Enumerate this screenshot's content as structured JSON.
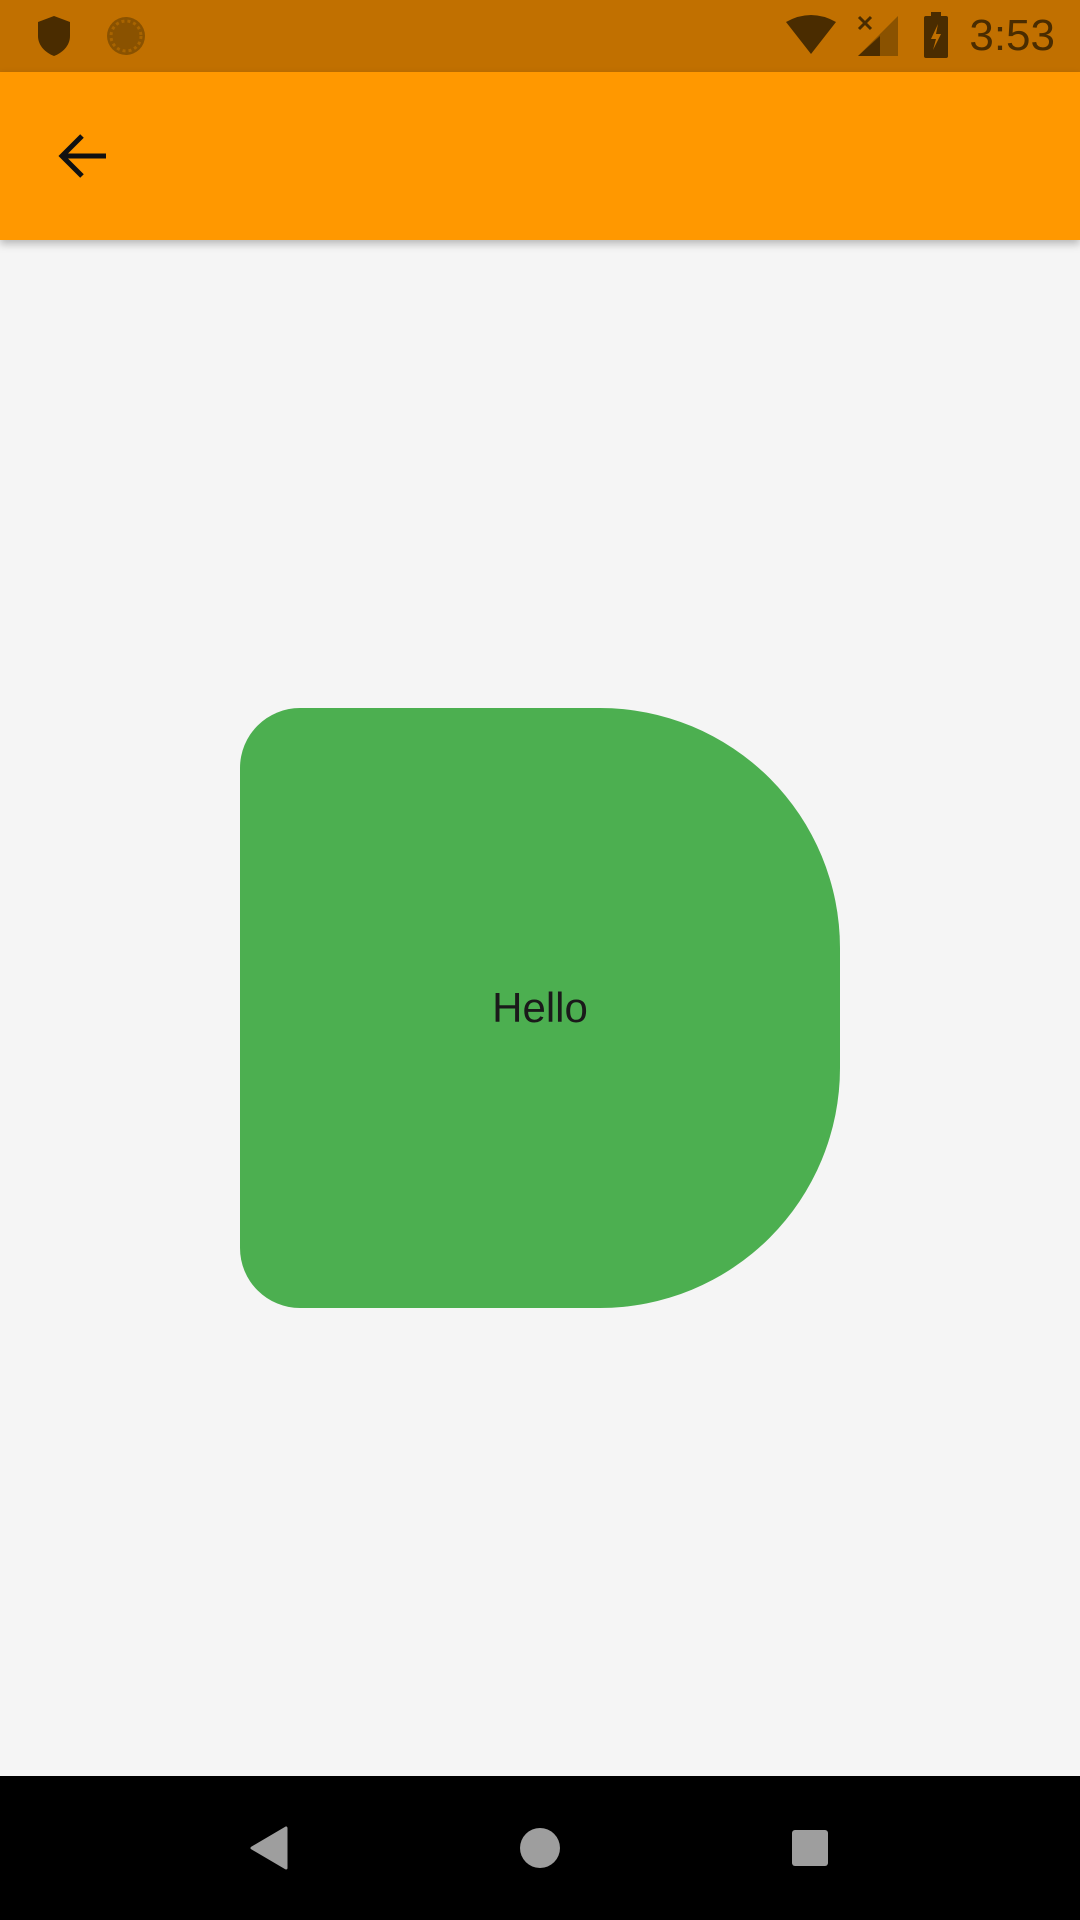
{
  "status_bar": {
    "time": "3:53",
    "icons": [
      "shield-icon",
      "sync-icon",
      "wifi-icon",
      "signal-no-service-icon",
      "battery-charging-icon"
    ]
  },
  "app_bar": {
    "back_icon": "arrow-back-icon"
  },
  "main": {
    "card": {
      "label": "Hello",
      "color": "#4caf50"
    }
  },
  "colors": {
    "status_bar": "#c17000",
    "app_bar": "#ff9800",
    "background": "#f5f5f5",
    "nav_bar": "#000000"
  },
  "nav_bar": {
    "buttons": [
      "back-triangle-icon",
      "home-circle-icon",
      "recents-square-icon"
    ]
  }
}
